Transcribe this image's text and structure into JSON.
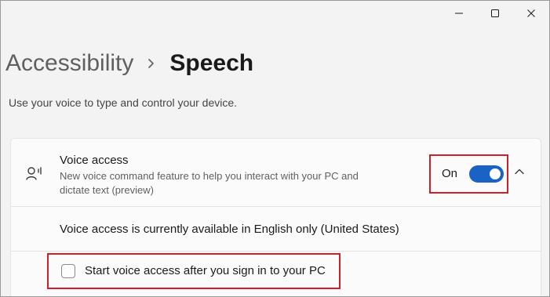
{
  "window": {
    "controls": [
      {
        "name": "minimize-button",
        "icon": "minimize-icon"
      },
      {
        "name": "maximize-button",
        "icon": "maximize-icon"
      },
      {
        "name": "close-button",
        "icon": "close-icon"
      }
    ]
  },
  "breadcrumb": {
    "parent": "Accessibility",
    "separator_icon": "chevron-right-icon",
    "current": "Speech"
  },
  "subtitle": "Use your voice to type and control your device.",
  "voice_access": {
    "icon": "voice-access-icon",
    "title": "Voice access",
    "description": "New voice command feature to help you interact with your PC and dictate text (preview)",
    "toggle_state": "On",
    "toggle_on": true,
    "expand_icon": "chevron-up-icon",
    "info": "Voice access is currently available in English only (United States)",
    "checkbox_label": "Start voice access after you sign in to your PC",
    "checkbox_checked": false
  },
  "colors": {
    "accent": "#1a63c4",
    "highlight": "#d11f2a"
  }
}
